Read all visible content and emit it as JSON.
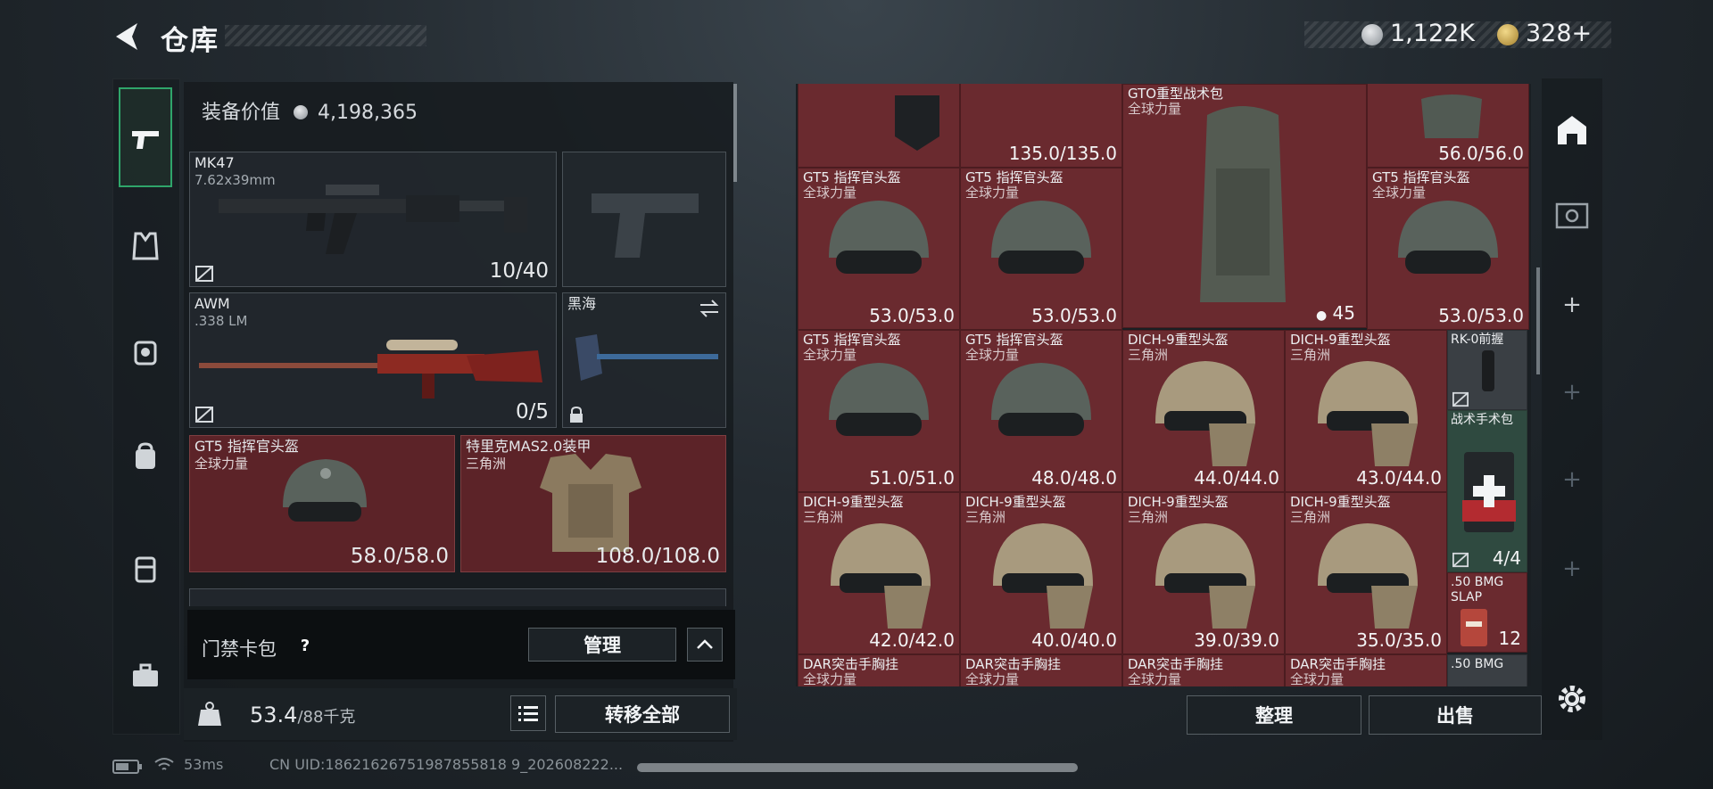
{
  "header": {
    "title": "仓库",
    "currency1": "1,122K",
    "currency2": "328+"
  },
  "left_rail": {
    "items": [
      "pistol-icon",
      "armor-vest-icon",
      "helmet-backpack-icon",
      "backpack-icon",
      "chest-rig-icon",
      "briefcase-icon"
    ]
  },
  "loadout": {
    "equip_value_label": "装备价值",
    "equip_value": "4,198,365",
    "primary": {
      "name": "MK47",
      "caliber": "7.62x39mm",
      "ammo": "10/40"
    },
    "secondary": {
      "name": "AWM",
      "caliber": ".338 LM",
      "ammo": "0/5"
    },
    "melee": {
      "name": "黑海"
    },
    "helmet": {
      "name": "GT5 指挥官头盔",
      "faction": "全球力量",
      "durability": "58.0/58.0"
    },
    "armor": {
      "name": "特里克MAS2.0装甲",
      "faction": "三角洲",
      "durability": "108.0/108.0"
    }
  },
  "access": {
    "label": "门禁卡包",
    "help": "?",
    "manage": "管理"
  },
  "weight": {
    "current": "53.4",
    "max": "/88千克",
    "transfer_all": "转移全部"
  },
  "storage": {
    "cells": [
      {
        "name": "",
        "sub": "",
        "dur": ""
      },
      {
        "name": "",
        "sub": "",
        "dur": "135.0/135.0"
      },
      {
        "name": "GTO重型战术包",
        "sub": "全球力量",
        "dur": "",
        "badge": "45"
      },
      {
        "name": "",
        "sub": "",
        "dur": "56.0/56.0"
      },
      {
        "name": "GT5 指挥官头盔",
        "sub": "全球力量",
        "dur": "53.0/53.0"
      },
      {
        "name": "GT5 指挥官头盔",
        "sub": "全球力量",
        "dur": "53.0/53.0"
      },
      {
        "name": "GT5 指挥官头盔",
        "sub": "全球力量",
        "dur": "53.0/53.0"
      },
      {
        "name": "GT5 指挥官头盔",
        "sub": "全球力量",
        "dur": "51.0/51.0"
      },
      {
        "name": "GT5 指挥官头盔",
        "sub": "全球力量",
        "dur": "48.0/48.0"
      },
      {
        "name": "DICH-9重型头盔",
        "sub": "三角洲",
        "dur": "44.0/44.0"
      },
      {
        "name": "DICH-9重型头盔",
        "sub": "三角洲",
        "dur": "43.0/44.0"
      },
      {
        "name": "DICH-9重型头盔",
        "sub": "三角洲",
        "dur": "42.0/42.0"
      },
      {
        "name": "DICH-9重型头盔",
        "sub": "三角洲",
        "dur": "40.0/40.0"
      },
      {
        "name": "DICH-9重型头盔",
        "sub": "三角洲",
        "dur": "39.0/39.0"
      },
      {
        "name": "DICH-9重型头盔",
        "sub": "三角洲",
        "dur": "35.0/35.0"
      },
      {
        "name": "DAR突击手胸挂",
        "sub": "全球力量",
        "dur": ""
      },
      {
        "name": "DAR突击手胸挂",
        "sub": "全球力量",
        "dur": ""
      },
      {
        "name": "DAR突击手胸挂",
        "sub": "全球力量",
        "dur": ""
      },
      {
        "name": "DAR突击手胸挂",
        "sub": "全球力量",
        "dur": ""
      }
    ],
    "side": [
      {
        "name": "RK-0前握",
        "dur": ""
      },
      {
        "name": "战术手术包",
        "dur": "4/4"
      },
      {
        "name": ".50 BMG SLAP",
        "dur": "12"
      },
      {
        "name": ".50 BMG",
        "dur": ""
      }
    ]
  },
  "actions": {
    "sort": "整理",
    "sell": "出售"
  },
  "status": {
    "ping": "53ms",
    "uid": "CN UID:18621626751987855818 9_202608222..."
  },
  "colors": {
    "accent_green": "#2fa56a",
    "cell_red": "#6a2a2f"
  }
}
